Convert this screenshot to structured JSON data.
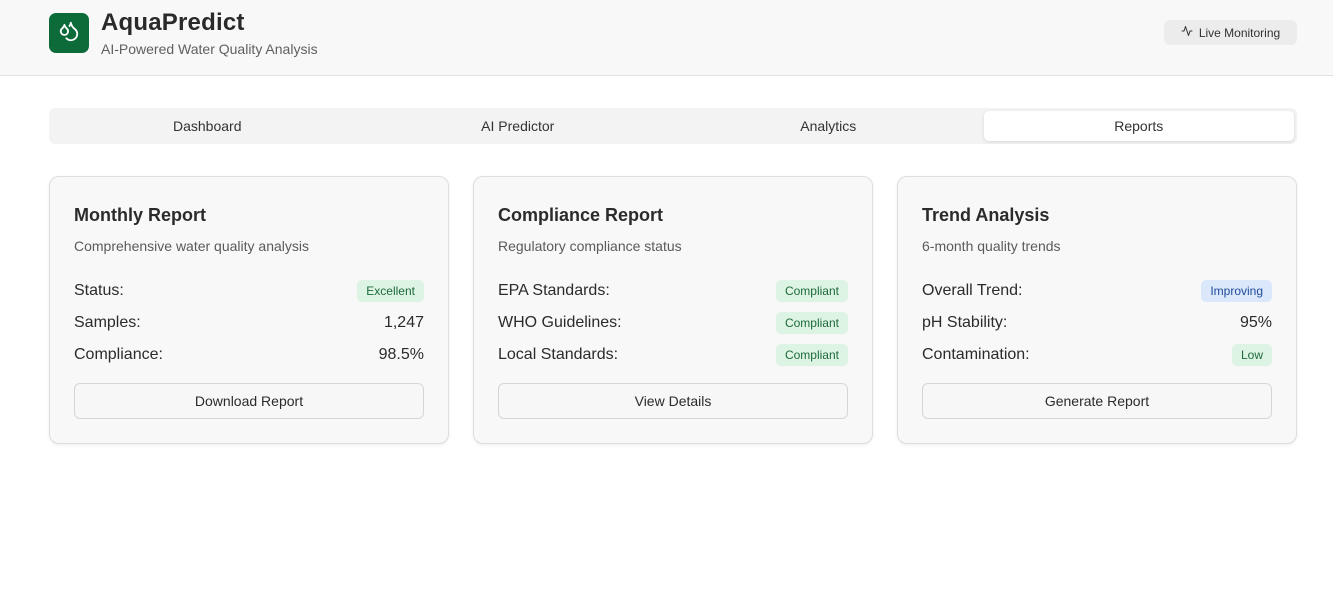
{
  "header": {
    "logo_icon": "droplets-icon",
    "title": "AquaPredict",
    "subtitle": "AI-Powered Water Quality Analysis",
    "live_icon": "activity-icon",
    "live_label": "Live Monitoring"
  },
  "tabs": [
    {
      "label": "Dashboard",
      "active": false
    },
    {
      "label": "AI Predictor",
      "active": false
    },
    {
      "label": "Analytics",
      "active": false
    },
    {
      "label": "Reports",
      "active": true
    }
  ],
  "cards": [
    {
      "title": "Monthly Report",
      "subtitle": "Comprehensive water quality analysis",
      "rows": [
        {
          "label": "Status:",
          "value": "Excellent",
          "badge": "green"
        },
        {
          "label": "Samples:",
          "value": "1,247"
        },
        {
          "label": "Compliance:",
          "value": "98.5%"
        }
      ],
      "button": "Download Report"
    },
    {
      "title": "Compliance Report",
      "subtitle": "Regulatory compliance status",
      "rows": [
        {
          "label": "EPA Standards:",
          "value": "Compliant",
          "badge": "green"
        },
        {
          "label": "WHO Guidelines:",
          "value": "Compliant",
          "badge": "green"
        },
        {
          "label": "Local Standards:",
          "value": "Compliant",
          "badge": "green"
        }
      ],
      "button": "View Details"
    },
    {
      "title": "Trend Analysis",
      "subtitle": "6-month quality trends",
      "rows": [
        {
          "label": "Overall Trend:",
          "value": "Improving",
          "badge": "blue"
        },
        {
          "label": "pH Stability:",
          "value": "95%"
        },
        {
          "label": "Contamination:",
          "value": "Low",
          "badge": "green"
        }
      ],
      "button": "Generate Report"
    }
  ],
  "colors": {
    "brand": "#0d6b3a",
    "badge_green_bg": "#ddf3e4",
    "badge_green_text": "#1d6b3c",
    "badge_blue_bg": "#dbe7fb",
    "badge_blue_text": "#1f4a99"
  }
}
